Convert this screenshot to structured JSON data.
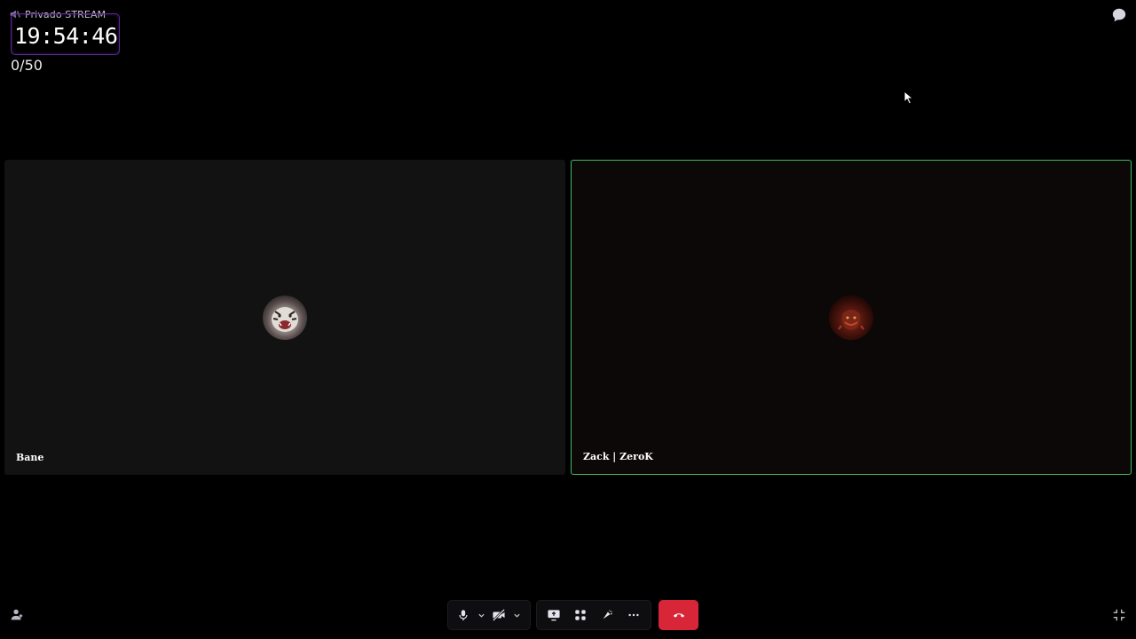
{
  "channel": {
    "name": "Privado STREAM"
  },
  "timer": {
    "value": "19:54:46"
  },
  "counter": {
    "value": "0/50"
  },
  "tiles": [
    {
      "name": "Bane",
      "active_speaker": false
    },
    {
      "name": "Zack | ZeroK",
      "active_speaker": true
    }
  ],
  "controls": {
    "media": [
      {
        "icon": "microphone-icon",
        "caret": "chevron-down-icon"
      },
      {
        "icon": "camera-off-icon",
        "caret": "chevron-down-icon"
      }
    ],
    "actions": [
      {
        "icon": "screen-share-icon"
      },
      {
        "icon": "activities-icon"
      },
      {
        "icon": "soundboard-icon"
      },
      {
        "icon": "more-options-icon"
      }
    ],
    "hangup": {
      "icon": "hang-up-icon",
      "color": "#d72638"
    }
  },
  "colors": {
    "active_speaker_border": "#3dbd64",
    "timer_border": "#5a2a8a",
    "background": "#000000"
  }
}
